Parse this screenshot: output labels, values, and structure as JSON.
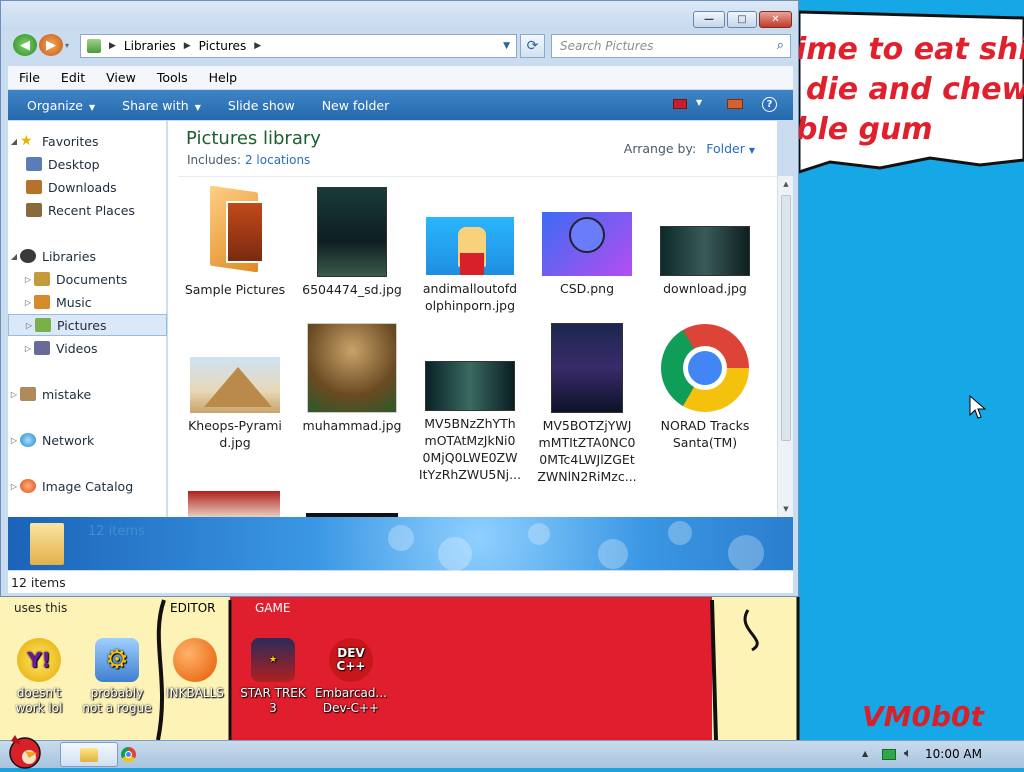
{
  "window": {
    "title_buttons": {
      "minimize": "—",
      "maximize": "□",
      "close": "✕"
    },
    "address": {
      "crumbs": [
        "Libraries",
        "Pictures"
      ]
    },
    "search": {
      "placeholder": "Search Pictures"
    },
    "menu": [
      "File",
      "Edit",
      "View",
      "Tools",
      "Help"
    ],
    "commands": [
      "Organize",
      "Share with",
      "Slide show",
      "New folder"
    ],
    "nav": {
      "favorites": {
        "label": "Favorites",
        "items": [
          "Desktop",
          "Downloads",
          "Recent Places"
        ]
      },
      "libraries": {
        "label": "Libraries",
        "items": [
          "Documents",
          "Music",
          "Pictures",
          "Videos"
        ]
      },
      "others": [
        "mistake",
        "Network",
        "Image Catalog"
      ]
    },
    "library": {
      "title": "Pictures library",
      "includes_label": "Includes:",
      "includes_link": "2 locations",
      "arrange_label": "Arrange by:",
      "arrange_value": "Folder"
    },
    "files": [
      {
        "name": "Sample Pictures",
        "kind": "folder-icon"
      },
      {
        "name": "6504474_sd.jpg",
        "kind": "image-thumb"
      },
      {
        "name": "andimalloutofd\nolphinporn.jpg",
        "kind": "image-thumb"
      },
      {
        "name": "CSD.png",
        "kind": "image-thumb"
      },
      {
        "name": "download.jpg",
        "kind": "image-thumb"
      },
      {
        "name": "Kheops-Pyrami\nd.jpg",
        "kind": "image-thumb"
      },
      {
        "name": "muhammad.jpg",
        "kind": "image-thumb"
      },
      {
        "name": "MV5BNzZhYTh\nmOTAtMzJkNi0\n0MjQ0LWE0ZW\nItYzRhZWU5Nj...",
        "kind": "image-thumb"
      },
      {
        "name": "MV5BOTZjYWJ\nmMTItZTA0NC0\n0MTc4LWJlZGEt\nZWNlN2RiMzc...",
        "kind": "image-thumb"
      },
      {
        "name": "NORAD Tracks\nSanta(TM)",
        "kind": "chrome-icon"
      }
    ],
    "details_count": "12 items",
    "status_count": "12 items"
  },
  "wallpaper": {
    "text_lines": [
      "ime to eat shit",
      "die and chew",
      "ble gum"
    ],
    "signature": "VM0b0t",
    "labels": [
      "uses this",
      "EDITOR",
      "GAME"
    ]
  },
  "desktop_icons": [
    {
      "label": "doesn't\nwork lol",
      "icon": "yahoo-messenger-icon"
    },
    {
      "label": "probably\nnot a rogue",
      "icon": "gears-icon"
    },
    {
      "label": "INKBALLS",
      "icon": "inkball-icon"
    },
    {
      "label": "STAR TREK\n3",
      "icon": "star-wars-icon"
    },
    {
      "label": "Embarcad...\nDev-C++",
      "icon": "devcpp-icon"
    }
  ],
  "taskbar": {
    "clock": "10:00 AM"
  },
  "colors": {
    "command_bar": "#2a6fb2",
    "library_title": "#1d5f2e",
    "link": "#2a6cc0",
    "wall_red": "#e0202c"
  }
}
